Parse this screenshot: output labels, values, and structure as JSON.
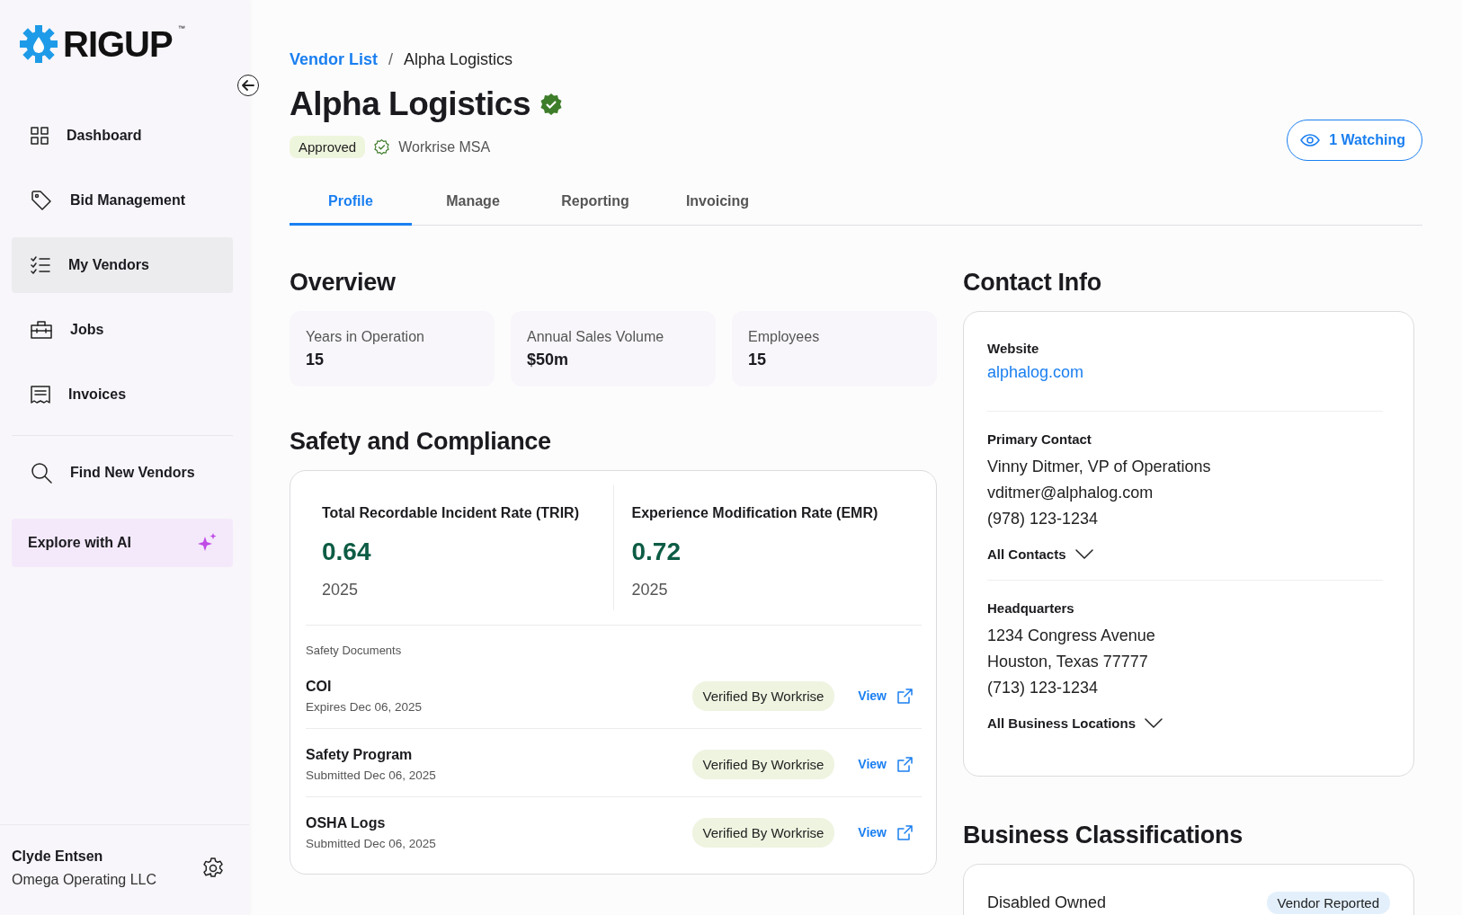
{
  "sidebar": {
    "logo": {
      "text": "RIGUP",
      "mark": "™"
    },
    "nav_primary": [
      {
        "label": "Dashboard",
        "selected": false
      },
      {
        "label": "Bid Management",
        "selected": false
      },
      {
        "label": "My Vendors",
        "selected": true
      },
      {
        "label": "Jobs",
        "selected": false
      },
      {
        "label": "Invoices",
        "selected": false
      }
    ],
    "nav_secondary": [
      {
        "label": "Find New Vendors",
        "kind": "link",
        "selected": false
      },
      {
        "label": "Explore with AI",
        "kind": "ai",
        "selected": false
      }
    ],
    "user": {
      "name": "Clyde Entsen",
      "company": "Omega Operating LLC"
    }
  },
  "breadcrumb": {
    "separator": "/",
    "items": [
      {
        "label": "Vendor List",
        "kind": "link"
      },
      {
        "label": "Alpha Logistics",
        "kind": "current"
      }
    ]
  },
  "header": {
    "title": "Alpha Logistics",
    "verified": true,
    "status": "Approved",
    "msa": "Workrise MSA",
    "watch_button": "1 Watching"
  },
  "tabs": [
    {
      "label": "Profile",
      "selected": true
    },
    {
      "label": "Manage",
      "selected": false
    },
    {
      "label": "Reporting",
      "selected": false
    },
    {
      "label": "Invoicing",
      "selected": false
    }
  ],
  "overview": {
    "title": "Overview",
    "stats": [
      {
        "label": "Years in Operation",
        "value": "15"
      },
      {
        "label": "Annual Sales Volume",
        "value": "$50m"
      },
      {
        "label": "Employees",
        "value": "15"
      }
    ]
  },
  "safety": {
    "title": "Safety and Compliance",
    "metrics": [
      {
        "label": "Total Recordable Incident Rate (TRIR)",
        "value": "0.64",
        "year": "2025"
      },
      {
        "label": "Experience Modification Rate (EMR)",
        "value": "0.72",
        "year": "2025"
      }
    ],
    "documents_label": "Safety Documents",
    "documents": [
      {
        "name": "COI",
        "date": "Expires Dec 06, 2025",
        "status": "Verified By Workrise",
        "action": "View"
      },
      {
        "name": "Safety Program",
        "date": "Submitted Dec 06, 2025",
        "status": "Verified By Workrise",
        "action": "View"
      },
      {
        "name": "OSHA Logs",
        "date": "Submitted Dec 06, 2025",
        "status": "Verified By Workrise",
        "action": "View"
      }
    ]
  },
  "contact": {
    "title": "Contact Info",
    "website": {
      "label": "Website",
      "value": "alphalog.com"
    },
    "primary_contact": {
      "label": "Primary Contact",
      "lines": [
        "Vinny Ditmer, VP of Operations",
        "vditmer@alphalog.com",
        "(978) 123-1234"
      ],
      "toggle": "All Contacts",
      "expanded": false
    },
    "headquarters": {
      "label": "Headquarters",
      "lines": [
        "1234 Congress Avenue",
        "Houston, Texas 77777",
        "(713) 123-1234"
      ],
      "toggle": "All Business Locations",
      "expanded": false
    }
  },
  "classifications": {
    "title": "Business Classifications",
    "items": [
      {
        "name": "Disabled Owned",
        "tag": "Vendor Reported"
      }
    ]
  }
}
